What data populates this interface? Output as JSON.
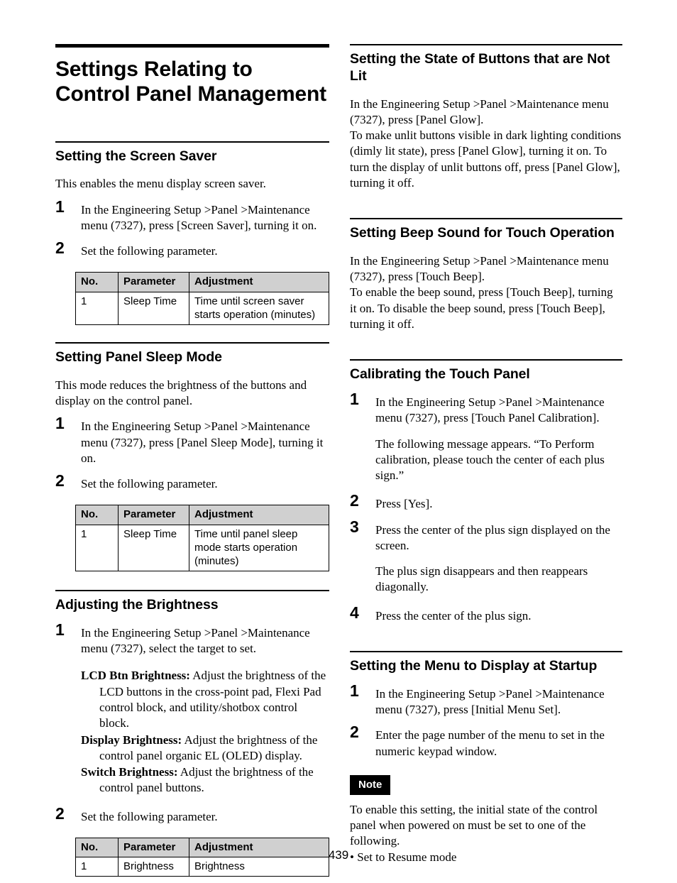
{
  "page": {
    "folio": "439"
  },
  "document": {
    "title": "Settings Relating to Control Panel Management"
  },
  "table_headers": {
    "no": "No.",
    "parameter": "Parameter",
    "adjustment": "Adjustment"
  },
  "left_column": {
    "screen_saver": {
      "heading": "Setting the Screen Saver",
      "intro": "This enables the menu display screen saver.",
      "step1_num": "1",
      "step1_text": "In the Engineering Setup >Panel >Maintenance menu (7327), press [Screen Saver], turning it on.",
      "step2_num": "2",
      "step2_text": "Set the following parameter.",
      "table_row": {
        "no": "1",
        "parameter": "Sleep Time",
        "adjustment": "Time until screen saver starts operation (minutes)"
      }
    },
    "panel_sleep": {
      "heading": "Setting Panel Sleep Mode",
      "intro": "This mode reduces the brightness of the buttons and display on the control panel.",
      "step1_num": "1",
      "step1_text": "In the Engineering Setup >Panel >Maintenance menu (7327), press [Panel Sleep Mode], turning it on.",
      "step2_num": "2",
      "step2_text": "Set the following parameter.",
      "table_row": {
        "no": "1",
        "parameter": "Sleep Time",
        "adjustment": "Time until panel sleep mode starts operation (minutes)"
      }
    },
    "brightness": {
      "heading": "Adjusting the Brightness",
      "step1_num": "1",
      "step1_text": "In the Engineering Setup >Panel >Maintenance menu (7327), select the target to set.",
      "definitions": [
        {
          "term": "LCD Btn Brightness:",
          "desc": " Adjust the brightness of the LCD buttons in the cross-point pad, Flexi Pad control block, and utility/shotbox control block."
        },
        {
          "term": "Display Brightness:",
          "desc": " Adjust the brightness of the control panel organic EL (OLED) display."
        },
        {
          "term": "Switch Brightness:",
          "desc": " Adjust the brightness of the control panel buttons."
        }
      ],
      "step2_num": "2",
      "step2_text": "Set the following parameter.",
      "table_row": {
        "no": "1",
        "parameter": "Brightness",
        "adjustment": "Brightness"
      }
    }
  },
  "right_column": {
    "not_lit": {
      "heading": "Setting the State of Buttons that are Not Lit",
      "para1": "In the Engineering Setup >Panel >Maintenance menu (7327), press [Panel Glow].",
      "para2": "To make unlit buttons visible in dark lighting conditions (dimly lit state), press [Panel Glow], turning it on. To turn the display of unlit buttons off, press [Panel Glow], turning it off."
    },
    "beep": {
      "heading": "Setting Beep Sound for Touch Operation",
      "para1": "In the Engineering Setup >Panel >Maintenance menu (7327), press [Touch Beep].",
      "para2": "To enable the beep sound, press [Touch Beep], turning it on. To disable the beep sound, press [Touch Beep], turning it off."
    },
    "calibration": {
      "heading": "Calibrating the Touch Panel",
      "step1_num": "1",
      "step1_text": "In the Engineering Setup >Panel >Maintenance menu (7327), press [Touch Panel Calibration].",
      "step1_sub": "The following message appears. “To Perform calibration, please touch the center of each plus sign.”",
      "step2_num": "2",
      "step2_text": "Press [Yes].",
      "step3_num": "3",
      "step3_text": "Press the center of the plus sign displayed on the screen.",
      "step3_sub": "The plus sign disappears and then reappears diagonally.",
      "step4_num": "4",
      "step4_text": "Press the center of the plus sign."
    },
    "startup_menu": {
      "heading": "Setting the Menu to Display at Startup",
      "step1_num": "1",
      "step1_text": "In the Engineering Setup >Panel >Maintenance menu (7327), press [Initial Menu Set].",
      "step2_num": "2",
      "step2_text": "Enter the page number of the menu to set in the numeric keypad window.",
      "note": {
        "label": "Note",
        "body": "To enable this setting, the initial state of the control panel when powered on must be set to one of the following.",
        "bullet": "• Set to Resume mode"
      }
    }
  }
}
